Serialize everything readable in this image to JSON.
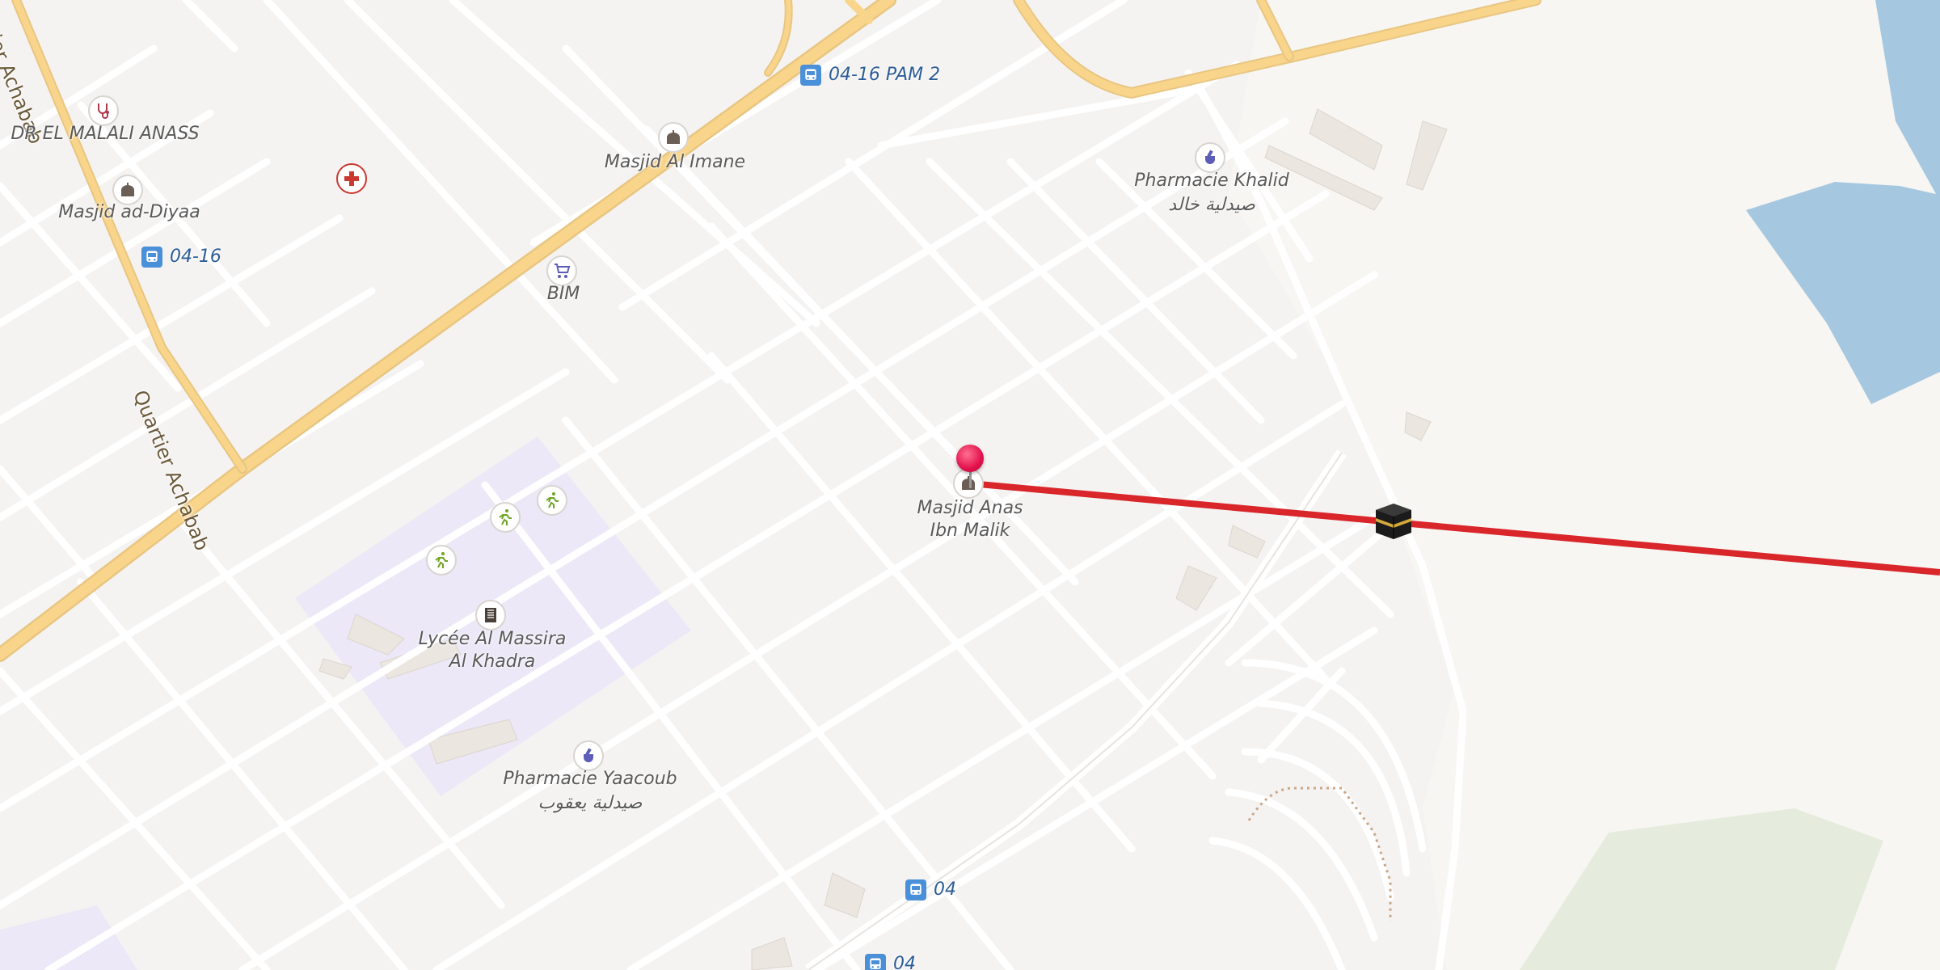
{
  "map": {
    "roads": {
      "quartier_achabab": "Quartier Achabab",
      "quartier_achabab_top": "ier Achabab"
    },
    "pois": {
      "dr_malali": "DR EL MALALI ANASS",
      "masjid_ad_diyaa": "Masjid ad-Diyaa",
      "masjid_al_imane": "Masjid Al Imane",
      "bim": "BIM",
      "pharmacie_khalid": "Pharmacie Khalid",
      "pharmacie_khalid_ar": "صيدلية خالد",
      "masjid_anas_line1": "Masjid Anas",
      "masjid_anas_line2": "Ibn Malik",
      "lycee_line1": "Lycée Al Massira",
      "lycee_line2": "Al Khadra",
      "pharmacie_yaacoub": "Pharmacie Yaacoub",
      "pharmacie_yaacoub_ar": "صيدلية يعقوب"
    },
    "bus_stops": {
      "pam2": "04-16 PAM 2",
      "stop_0416": "04-16",
      "stop_04": "04",
      "stop_04_bottom": "04"
    },
    "icons": {
      "doctor": "stethoscope-icon",
      "mosque": "mosque-icon",
      "shop": "shopping-cart-icon",
      "pharmacy": "pharmacy-icon",
      "hospital": "red-cross-icon",
      "school": "school-icon",
      "sports": "running-icon",
      "bus": "bus-icon",
      "qibla": "kaaba-icon",
      "location": "location-pin-icon"
    },
    "colors": {
      "qibla_line": "#d9262b",
      "main_road": "#f9d58b",
      "water": "#a5c8e0",
      "school_area": "#ece8f7",
      "park": "#e6ecdd",
      "pin": "#e3114d"
    }
  }
}
